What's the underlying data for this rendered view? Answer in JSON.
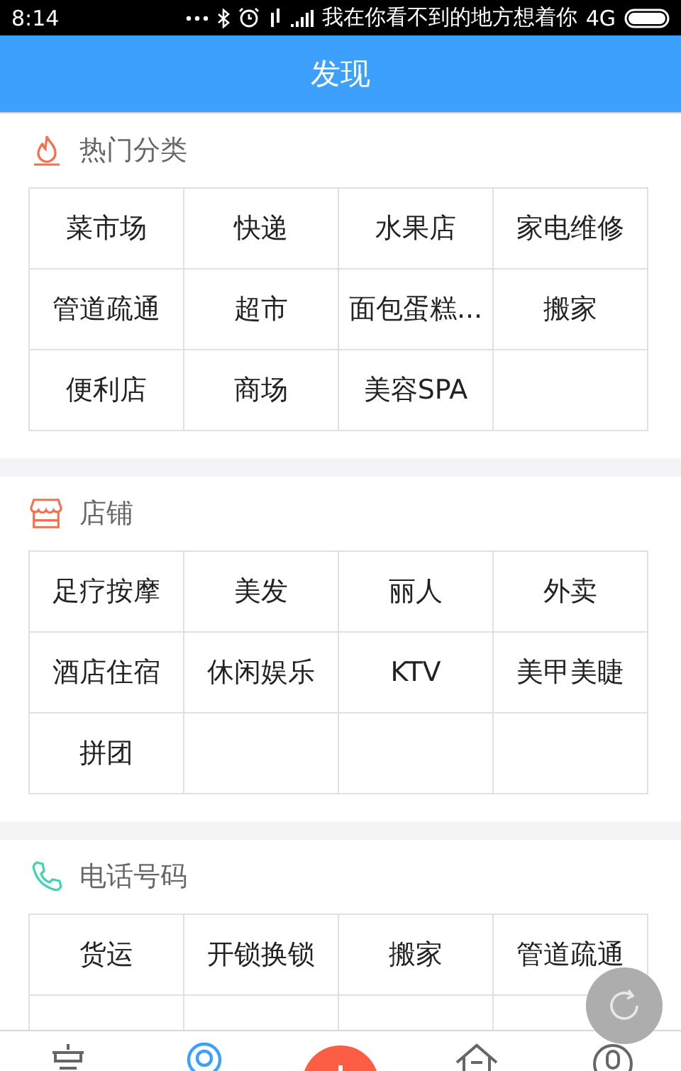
{
  "status_bar": {
    "time": "8:14",
    "carrier": "我在你看不到的地方想着你",
    "network": "4G"
  },
  "header": {
    "title": "发现"
  },
  "sections": [
    {
      "kind": "fire",
      "title": "热门分类",
      "items": [
        "菜市场",
        "快递",
        "水果店",
        "家电维修",
        "管道疏通",
        "超市",
        "面包蛋糕...",
        "搬家",
        "便利店",
        "商场",
        "美容SPA"
      ]
    },
    {
      "kind": "shop",
      "title": "店铺",
      "items": [
        "足疗按摩",
        "美发",
        "丽人",
        "外卖",
        "酒店住宿",
        "休闲娱乐",
        "KTV",
        "美甲美睫",
        "拼团"
      ]
    },
    {
      "kind": "phone",
      "title": "电话号码",
      "items": [
        "货运",
        "开锁换锁",
        "搬家",
        "管道疏通"
      ]
    }
  ],
  "bottom_nav": [
    {
      "kind": "doc",
      "selected": false
    },
    {
      "kind": "pin",
      "selected": true
    },
    {
      "kind": "add",
      "selected": false
    },
    {
      "kind": "home",
      "selected": false
    },
    {
      "kind": "user",
      "selected": false
    }
  ]
}
